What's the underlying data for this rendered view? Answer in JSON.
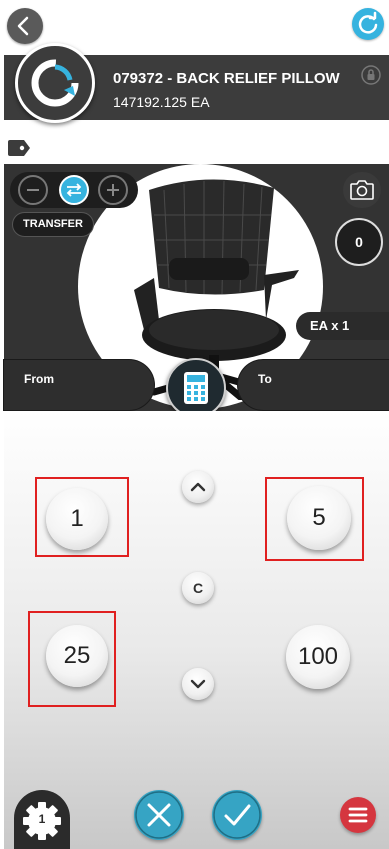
{
  "header": {
    "item_title": "079372 - BACK RELIEF PILLOW",
    "item_quantity": "147192.125 EA"
  },
  "scan": {
    "mode_label": "TRANSFER",
    "count": "0",
    "uom": "EA x 1"
  },
  "locations": {
    "from_label": "From",
    "to_label": "To"
  },
  "keypad": {
    "quick_values": [
      "1",
      "5",
      "25",
      "100"
    ],
    "clear_label": "C"
  },
  "footer": {
    "settings_badge": "1"
  },
  "icons": [
    "back-arrow-icon",
    "refresh-icon",
    "lock-icon",
    "tag-icon",
    "minus-icon",
    "transfer-icon",
    "plus-icon",
    "camera-icon",
    "calculator-icon",
    "chevron-up-icon",
    "chevron-down-icon",
    "gear-icon",
    "close-icon",
    "check-icon",
    "menu-icon"
  ],
  "colors": {
    "accent_blue": "#36b3df",
    "header_dark": "#3c3c3c",
    "menu_red": "#d5363f",
    "highlight_red": "#e02020"
  }
}
